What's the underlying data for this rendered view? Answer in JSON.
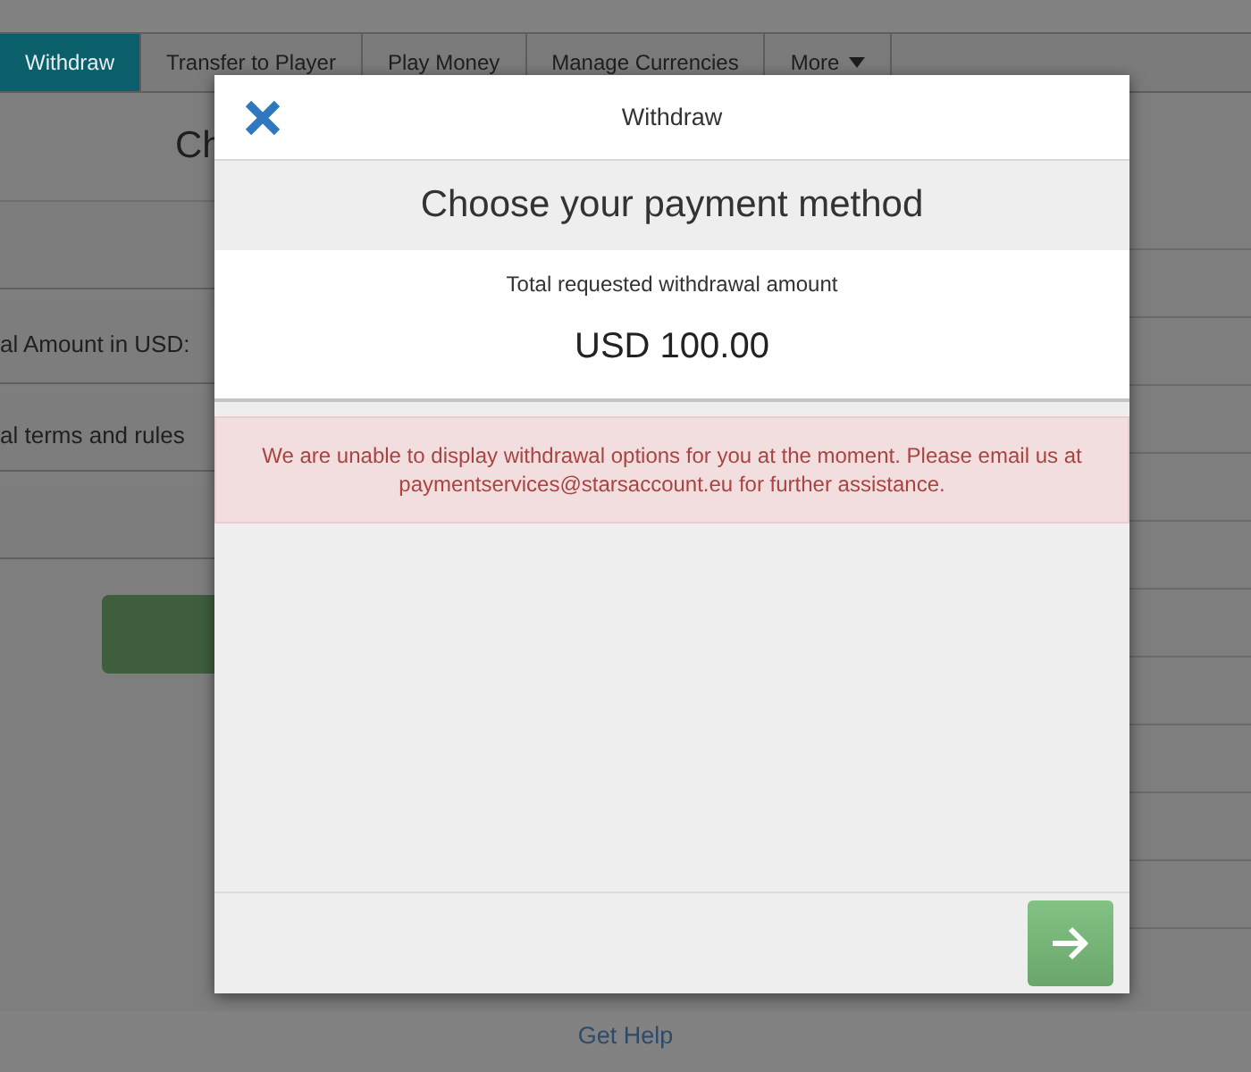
{
  "tabs": [
    {
      "label": "Withdraw",
      "selected": true
    },
    {
      "label": "Transfer to Player",
      "selected": false
    },
    {
      "label": "Play Money",
      "selected": false
    },
    {
      "label": "Manage Currencies",
      "selected": false
    },
    {
      "label": "More",
      "selected": false,
      "kind": "dropdown"
    }
  ],
  "page": {
    "heading": "Ch",
    "fields": [
      "al Amount in USD:",
      "al terms and rules"
    ]
  },
  "footer": {
    "link": "Get Help"
  },
  "modal": {
    "title": "Withdraw",
    "heading": "Choose your payment method",
    "amount_label": "Total requested withdrawal amount",
    "amount": "USD 100.00",
    "alert": "We are unable to display withdrawal options for you at the moment. Please email us at paymentservices@starsaccount.eu for further assistance."
  }
}
